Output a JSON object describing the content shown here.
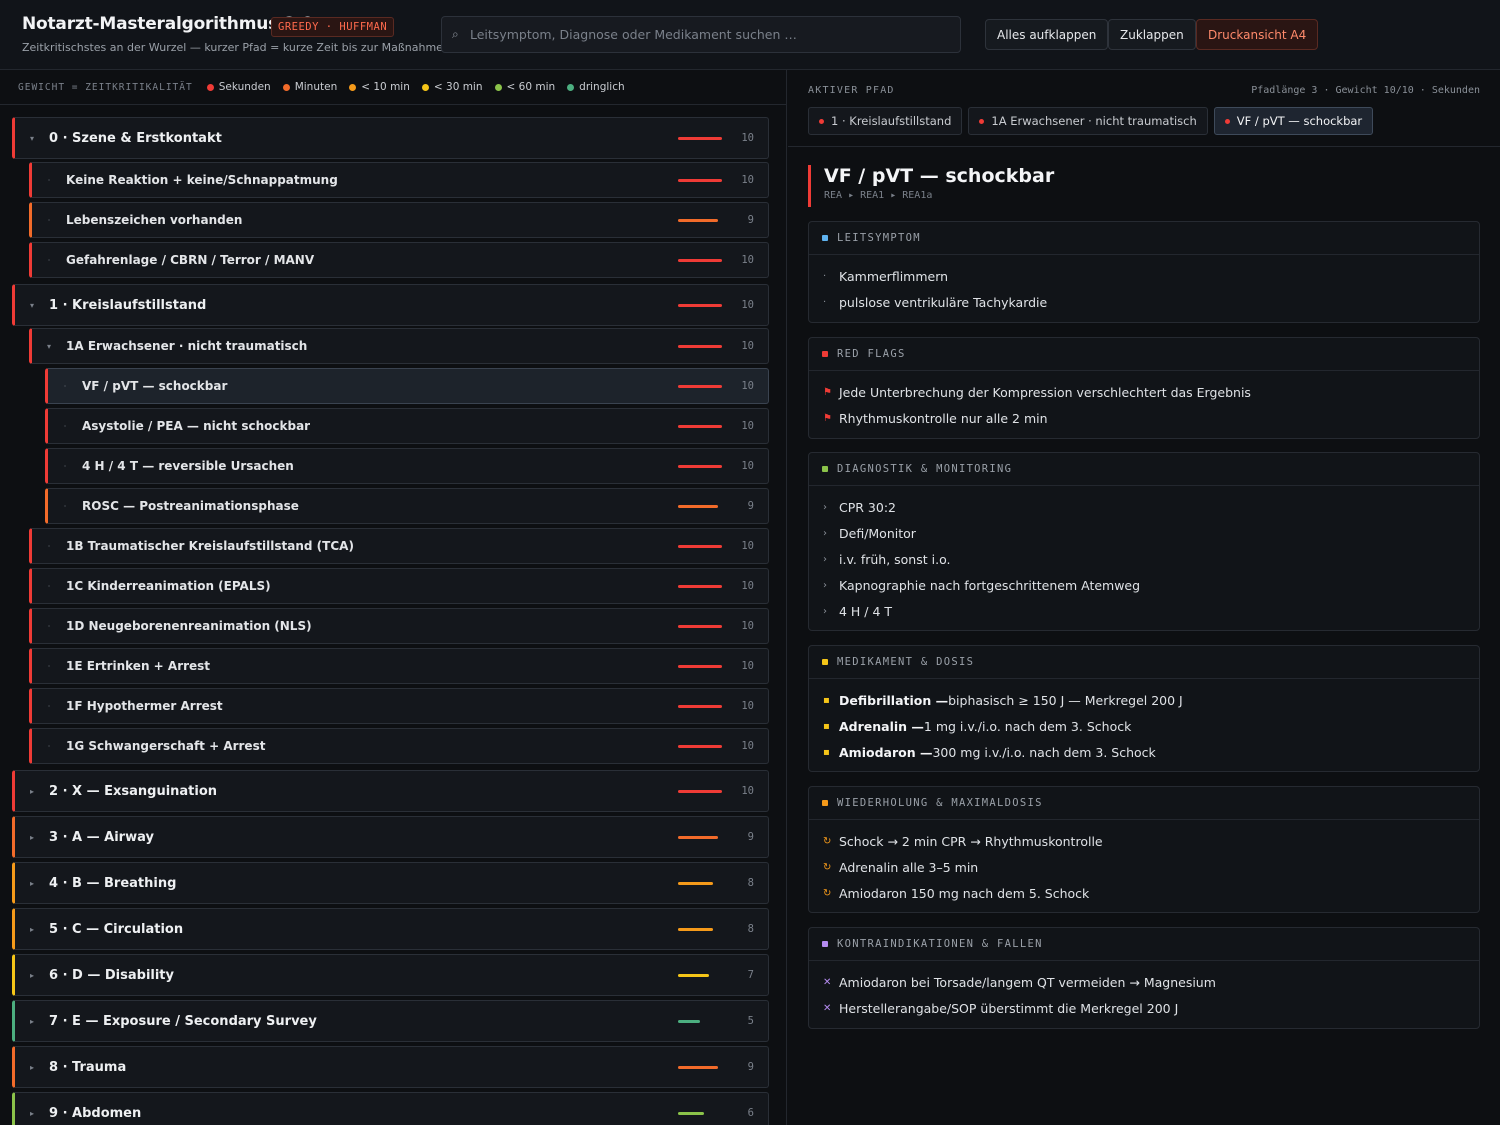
{
  "header": {
    "title": "Notarzt-Masteralgorithmus 2.0",
    "badge": "GREEDY · HUFFMAN",
    "subtitle": "Zeitkritischstes an der Wurzel — kurzer Pfad = kurze Zeit bis zur Maßnahme",
    "search_placeholder": "Leitsymptom, Diagnose oder Medikament suchen …",
    "buttons": {
      "expand": "Alles aufklappen",
      "collapse": "Zuklappen",
      "print": "Druckansicht A4"
    }
  },
  "legend": {
    "title": "GEWICHT = ZEITKRITIKALITÄT",
    "items": [
      {
        "label": "Sekunden",
        "color": "#ef3b36"
      },
      {
        "label": "Minuten",
        "color": "#f26b2a"
      },
      {
        "label": "< 10 min",
        "color": "#f59a1a"
      },
      {
        "label": "< 30 min",
        "color": "#f5c518"
      },
      {
        "label": "< 60 min",
        "color": "#8bc34a"
      },
      {
        "label": "dringlich",
        "color": "#4caf80"
      }
    ]
  },
  "tree": [
    {
      "label": "0 · Szene & Erstkontakt",
      "weight": 10,
      "level": 0,
      "expanded": true,
      "color": "#ef3b36"
    },
    {
      "label": "Keine Reaktion + keine/Schnappatmung",
      "weight": 10,
      "level": 1,
      "color": "#ef3b36"
    },
    {
      "label": "Lebenszeichen vorhanden",
      "weight": 9,
      "level": 1,
      "color": "#f26b2a"
    },
    {
      "label": "Gefahrenlage / CBRN / Terror / MANV",
      "weight": 10,
      "level": 1,
      "color": "#ef3b36"
    },
    {
      "label": "1 · Kreislaufstillstand",
      "weight": 10,
      "level": 0,
      "expanded": true,
      "color": "#ef3b36"
    },
    {
      "label": "1A Erwachsener · nicht traumatisch",
      "weight": 10,
      "level": 1,
      "expanded": true,
      "color": "#ef3b36"
    },
    {
      "label": "VF / pVT — schockbar",
      "weight": 10,
      "level": 2,
      "active": true,
      "color": "#ef3b36"
    },
    {
      "label": "Asystolie / PEA — nicht schockbar",
      "weight": 10,
      "level": 2,
      "color": "#ef3b36"
    },
    {
      "label": "4 H / 4 T — reversible Ursachen",
      "weight": 10,
      "level": 2,
      "color": "#ef3b36"
    },
    {
      "label": "ROSC — Postreanimationsphase",
      "weight": 9,
      "level": 2,
      "color": "#f26b2a"
    },
    {
      "label": "1B Traumatischer Kreislaufstillstand (TCA)",
      "weight": 10,
      "level": 1,
      "color": "#ef3b36"
    },
    {
      "label": "1C Kinderreanimation (EPALS)",
      "weight": 10,
      "level": 1,
      "color": "#ef3b36"
    },
    {
      "label": "1D Neugeborenenreanimation (NLS)",
      "weight": 10,
      "level": 1,
      "color": "#ef3b36"
    },
    {
      "label": "1E Ertrinken + Arrest",
      "weight": 10,
      "level": 1,
      "color": "#ef3b36"
    },
    {
      "label": "1F Hypothermer Arrest",
      "weight": 10,
      "level": 1,
      "color": "#ef3b36"
    },
    {
      "label": "1G Schwangerschaft + Arrest",
      "weight": 10,
      "level": 1,
      "color": "#ef3b36"
    },
    {
      "label": "2 · X — Exsanguination",
      "weight": 10,
      "level": 0,
      "color": "#ef3b36"
    },
    {
      "label": "3 · A — Airway",
      "weight": 9,
      "level": 0,
      "color": "#f26b2a"
    },
    {
      "label": "4 · B — Breathing",
      "weight": 8,
      "level": 0,
      "color": "#f59a1a"
    },
    {
      "label": "5 · C — Circulation",
      "weight": 8,
      "level": 0,
      "color": "#f59a1a"
    },
    {
      "label": "6 · D — Disability",
      "weight": 7,
      "level": 0,
      "color": "#f5c518"
    },
    {
      "label": "7 · E — Exposure / Secondary Survey",
      "weight": 5,
      "level": 0,
      "color": "#4caf80"
    },
    {
      "label": "8 · Trauma",
      "weight": 9,
      "level": 0,
      "color": "#f26b2a"
    },
    {
      "label": "9 · Abdomen",
      "weight": 6,
      "level": 0,
      "color": "#8bc34a"
    }
  ],
  "path": {
    "label": "AKTIVER PFAD",
    "meta": "Pfadlänge 3 · Gewicht 10/10 · Sekunden",
    "crumbs": [
      "1 · Kreislaufstillstand",
      "1A Erwachsener · nicht traumatisch",
      "VF / pVT — schockbar"
    ]
  },
  "detail": {
    "title": "VF / pVT — schockbar",
    "breadcrumb": "REA ▸ REA1 ▸ REA1a",
    "sections": [
      {
        "title": "LEITSYMPTOM",
        "color": "#5fb3f0",
        "bullet": "·",
        "items": [
          "Kammerflimmern",
          "pulslose ventrikuläre Tachykardie"
        ]
      },
      {
        "title": "RED FLAGS",
        "color": "#ef3b36",
        "bullet": "⚑",
        "items": [
          "Jede Unterbrechung der Kompression verschlechtert das Ergebnis",
          "Rhythmuskontrolle nur alle 2 min"
        ]
      },
      {
        "title": "DIAGNOSTIK & MONITORING",
        "color": "#8bc34a",
        "bullet": "›",
        "items": [
          "CPR 30:2",
          "Defi/Monitor",
          "i.v. früh, sonst i.o.",
          "Kapnographie nach fortgeschrittenem Atemweg",
          "4 H / 4 T"
        ]
      },
      {
        "title": "MEDIKAMENT & DOSIS",
        "color": "#f5c518",
        "bullet": "▪",
        "items": [
          {
            "strong": "Defibrillation —",
            "text": "biphasisch ≥ 150 J — Merkregel 200 J"
          },
          {
            "strong": "Adrenalin —",
            "text": "1 mg i.v./i.o. nach dem 3. Schock"
          },
          {
            "strong": "Amiodaron —",
            "text": "300 mg i.v./i.o. nach dem 3. Schock"
          }
        ]
      },
      {
        "title": "WIEDERHOLUNG & MAXIMALDOSIS",
        "color": "#f59a1a",
        "bullet": "↻",
        "items": [
          "Schock → 2 min CPR → Rhythmuskontrolle",
          "Adrenalin alle 3–5 min",
          "Amiodaron 150 mg nach dem 5. Schock"
        ]
      },
      {
        "title": "KONTRAINDIKATIONEN & FALLEN",
        "color": "#b58cf0",
        "bullet": "✕",
        "items": [
          "Amiodaron bei Torsade/langem QT vermeiden → Magnesium",
          "Herstellerangabe/SOP überstimmt die Merkregel 200 J"
        ]
      }
    ]
  }
}
